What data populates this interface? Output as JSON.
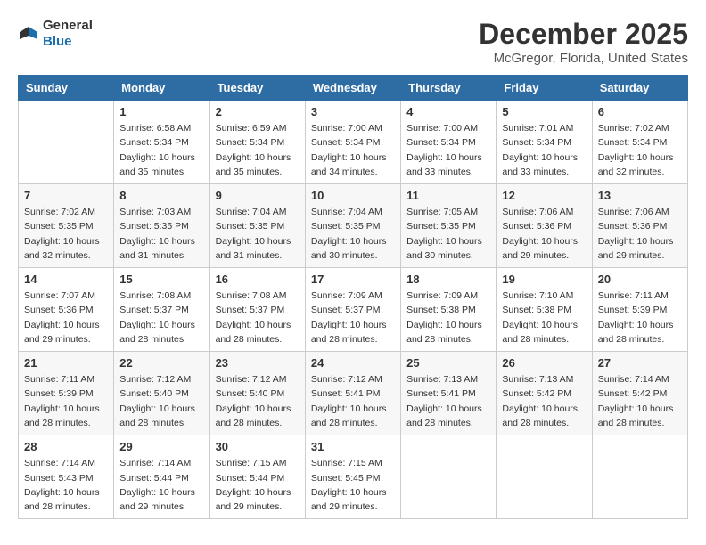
{
  "header": {
    "logo_general": "General",
    "logo_blue": "Blue",
    "month_title": "December 2025",
    "location": "McGregor, Florida, United States"
  },
  "days_of_week": [
    "Sunday",
    "Monday",
    "Tuesday",
    "Wednesday",
    "Thursday",
    "Friday",
    "Saturday"
  ],
  "weeks": [
    [
      {
        "day": "",
        "info": ""
      },
      {
        "day": "1",
        "info": "Sunrise: 6:58 AM\nSunset: 5:34 PM\nDaylight: 10 hours\nand 35 minutes."
      },
      {
        "day": "2",
        "info": "Sunrise: 6:59 AM\nSunset: 5:34 PM\nDaylight: 10 hours\nand 35 minutes."
      },
      {
        "day": "3",
        "info": "Sunrise: 7:00 AM\nSunset: 5:34 PM\nDaylight: 10 hours\nand 34 minutes."
      },
      {
        "day": "4",
        "info": "Sunrise: 7:00 AM\nSunset: 5:34 PM\nDaylight: 10 hours\nand 33 minutes."
      },
      {
        "day": "5",
        "info": "Sunrise: 7:01 AM\nSunset: 5:34 PM\nDaylight: 10 hours\nand 33 minutes."
      },
      {
        "day": "6",
        "info": "Sunrise: 7:02 AM\nSunset: 5:34 PM\nDaylight: 10 hours\nand 32 minutes."
      }
    ],
    [
      {
        "day": "7",
        "info": "Sunrise: 7:02 AM\nSunset: 5:35 PM\nDaylight: 10 hours\nand 32 minutes."
      },
      {
        "day": "8",
        "info": "Sunrise: 7:03 AM\nSunset: 5:35 PM\nDaylight: 10 hours\nand 31 minutes."
      },
      {
        "day": "9",
        "info": "Sunrise: 7:04 AM\nSunset: 5:35 PM\nDaylight: 10 hours\nand 31 minutes."
      },
      {
        "day": "10",
        "info": "Sunrise: 7:04 AM\nSunset: 5:35 PM\nDaylight: 10 hours\nand 30 minutes."
      },
      {
        "day": "11",
        "info": "Sunrise: 7:05 AM\nSunset: 5:35 PM\nDaylight: 10 hours\nand 30 minutes."
      },
      {
        "day": "12",
        "info": "Sunrise: 7:06 AM\nSunset: 5:36 PM\nDaylight: 10 hours\nand 29 minutes."
      },
      {
        "day": "13",
        "info": "Sunrise: 7:06 AM\nSunset: 5:36 PM\nDaylight: 10 hours\nand 29 minutes."
      }
    ],
    [
      {
        "day": "14",
        "info": "Sunrise: 7:07 AM\nSunset: 5:36 PM\nDaylight: 10 hours\nand 29 minutes."
      },
      {
        "day": "15",
        "info": "Sunrise: 7:08 AM\nSunset: 5:37 PM\nDaylight: 10 hours\nand 28 minutes."
      },
      {
        "day": "16",
        "info": "Sunrise: 7:08 AM\nSunset: 5:37 PM\nDaylight: 10 hours\nand 28 minutes."
      },
      {
        "day": "17",
        "info": "Sunrise: 7:09 AM\nSunset: 5:37 PM\nDaylight: 10 hours\nand 28 minutes."
      },
      {
        "day": "18",
        "info": "Sunrise: 7:09 AM\nSunset: 5:38 PM\nDaylight: 10 hours\nand 28 minutes."
      },
      {
        "day": "19",
        "info": "Sunrise: 7:10 AM\nSunset: 5:38 PM\nDaylight: 10 hours\nand 28 minutes."
      },
      {
        "day": "20",
        "info": "Sunrise: 7:11 AM\nSunset: 5:39 PM\nDaylight: 10 hours\nand 28 minutes."
      }
    ],
    [
      {
        "day": "21",
        "info": "Sunrise: 7:11 AM\nSunset: 5:39 PM\nDaylight: 10 hours\nand 28 minutes."
      },
      {
        "day": "22",
        "info": "Sunrise: 7:12 AM\nSunset: 5:40 PM\nDaylight: 10 hours\nand 28 minutes."
      },
      {
        "day": "23",
        "info": "Sunrise: 7:12 AM\nSunset: 5:40 PM\nDaylight: 10 hours\nand 28 minutes."
      },
      {
        "day": "24",
        "info": "Sunrise: 7:12 AM\nSunset: 5:41 PM\nDaylight: 10 hours\nand 28 minutes."
      },
      {
        "day": "25",
        "info": "Sunrise: 7:13 AM\nSunset: 5:41 PM\nDaylight: 10 hours\nand 28 minutes."
      },
      {
        "day": "26",
        "info": "Sunrise: 7:13 AM\nSunset: 5:42 PM\nDaylight: 10 hours\nand 28 minutes."
      },
      {
        "day": "27",
        "info": "Sunrise: 7:14 AM\nSunset: 5:42 PM\nDaylight: 10 hours\nand 28 minutes."
      }
    ],
    [
      {
        "day": "28",
        "info": "Sunrise: 7:14 AM\nSunset: 5:43 PM\nDaylight: 10 hours\nand 28 minutes."
      },
      {
        "day": "29",
        "info": "Sunrise: 7:14 AM\nSunset: 5:44 PM\nDaylight: 10 hours\nand 29 minutes."
      },
      {
        "day": "30",
        "info": "Sunrise: 7:15 AM\nSunset: 5:44 PM\nDaylight: 10 hours\nand 29 minutes."
      },
      {
        "day": "31",
        "info": "Sunrise: 7:15 AM\nSunset: 5:45 PM\nDaylight: 10 hours\nand 29 minutes."
      },
      {
        "day": "",
        "info": ""
      },
      {
        "day": "",
        "info": ""
      },
      {
        "day": "",
        "info": ""
      }
    ]
  ]
}
